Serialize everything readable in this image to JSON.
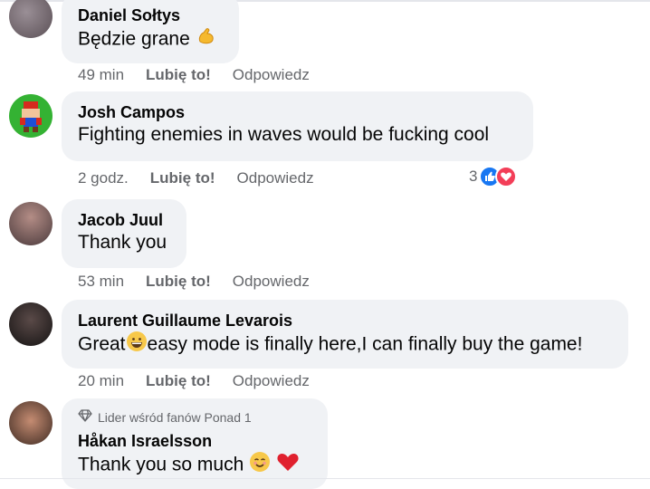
{
  "comments": [
    {
      "author": "Daniel Sołtys",
      "text": "Będzie grane",
      "emoji": "flexed-biceps",
      "time": "49 min",
      "like_label": "Lubię to!",
      "reply_label": "Odpowiedz"
    },
    {
      "author": "Josh Campos",
      "text": "Fighting enemies in waves would be fucking cool",
      "time": "2 godz.",
      "like_label": "Lubię to!",
      "reply_label": "Odpowiedz",
      "reactions": {
        "count": "3",
        "types": [
          "like",
          "love"
        ]
      }
    },
    {
      "author": "Jacob Juul",
      "text": "Thank you",
      "time": "53 min",
      "like_label": "Lubię to!",
      "reply_label": "Odpowiedz"
    },
    {
      "author": "Laurent Guillaume Levarois",
      "text_before": "Great",
      "text_after": "easy mode is finally here,I can finally buy the game!",
      "emoji": "grinning-face",
      "time": "20 min",
      "like_label": "Lubię to!",
      "reply_label": "Odpowiedz"
    },
    {
      "badge": "Lider wśród fanów Ponad 1",
      "author": "Håkan Israelsson",
      "text": "Thank you so much",
      "emojis": [
        "smiling-face",
        "red-heart"
      ]
    }
  ],
  "colors": {
    "bubble": "#f0f2f5",
    "secondary_text": "#65676b",
    "like_blue": "#1877f2",
    "love_red": "#f33e58"
  }
}
